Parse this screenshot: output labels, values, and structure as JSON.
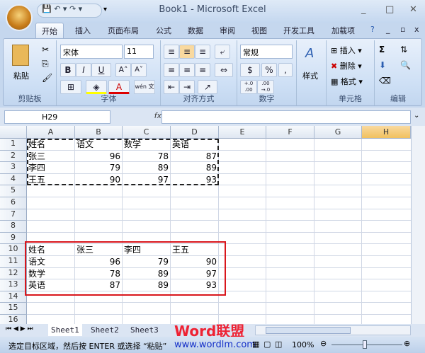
{
  "window": {
    "title": "Book1 - Microsoft Excel"
  },
  "qat": {
    "save": "💾",
    "undo": "↶ ▾",
    "redo": "↷ ▾",
    "more": "▾"
  },
  "tabs": [
    "开始",
    "插入",
    "页面布局",
    "公式",
    "数据",
    "审阅",
    "视图",
    "开发工具",
    "加载项"
  ],
  "ribbon": {
    "clipboard": {
      "paste": "粘贴",
      "label": "剪贴板"
    },
    "font": {
      "name": "宋体",
      "size": "11",
      "bold": "B",
      "italic": "I",
      "underline": "U",
      "grow": "A˄",
      "shrink": "A˅",
      "phonetic": "wén 文",
      "label": "字体"
    },
    "alignment": {
      "label": "对齐方式"
    },
    "number": {
      "format": "常规",
      "percent": "%",
      "comma": ",",
      "inc": "+.0 .00",
      "dec": ".00 →.0",
      "label": "数字"
    },
    "styles": {
      "label": "样式"
    },
    "cells": {
      "insert": "插入",
      "delete": "删除",
      "format": "格式",
      "label": "单元格"
    },
    "editing": {
      "sum": "Σ",
      "label": "编辑"
    }
  },
  "formula_bar": {
    "name_box": "H29",
    "fx": "fx",
    "value": ""
  },
  "columns": [
    "A",
    "B",
    "C",
    "D",
    "E",
    "F",
    "G",
    "H"
  ],
  "rows": [
    "1",
    "2",
    "3",
    "4",
    "5",
    "6",
    "7",
    "8",
    "9",
    "10",
    "11",
    "12",
    "13",
    "14",
    "15",
    "16"
  ],
  "table1": {
    "header": [
      "姓名",
      "语文",
      "数学",
      "英语"
    ],
    "rows": [
      [
        "张三",
        "96",
        "78",
        "87"
      ],
      [
        "李四",
        "79",
        "89",
        "89"
      ],
      [
        "王五",
        "90",
        "97",
        "93"
      ]
    ]
  },
  "table2": {
    "header": [
      "姓名",
      "张三",
      "李四",
      "王五"
    ],
    "rows": [
      [
        "语文",
        "96",
        "79",
        "90"
      ],
      [
        "数学",
        "78",
        "89",
        "97"
      ],
      [
        "英语",
        "87",
        "89",
        "93"
      ]
    ]
  },
  "sheets": [
    "Sheet1",
    "Sheet2",
    "Sheet3"
  ],
  "status": {
    "message": "选定目标区域，然后按 ENTER 或选择 “粘贴”",
    "zoom": "100%"
  },
  "watermark": {
    "brand": "Word联盟",
    "url": "www.wordlm.com"
  }
}
